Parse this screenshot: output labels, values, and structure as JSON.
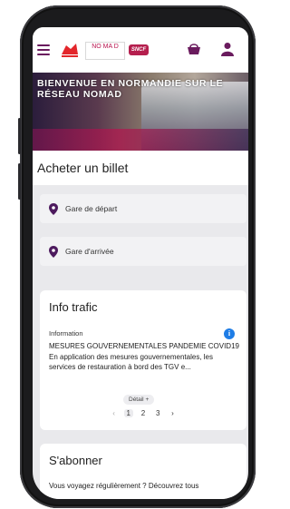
{
  "header": {
    "menu_icon": "hamburger-icon",
    "logos": [
      "region-normandie-logo",
      "nomad-logo",
      "sncf-logo"
    ],
    "nomad_logo_text": "NO MA D",
    "sncf_logo_text": "SNCF",
    "basket_icon": "basket-icon",
    "user_icon": "user-icon",
    "accent_color": "#6a1b5e"
  },
  "hero": {
    "title": "BIENVENUE EN NORMANDIE SUR LE RÉSEAU NOMAD"
  },
  "booking": {
    "title": "Acheter un billet",
    "departure_placeholder": "Gare de départ",
    "arrival_placeholder": "Gare d'arrivée",
    "pin_icon": "location-pin-icon"
  },
  "traffic": {
    "title": "Info trafic",
    "label": "Information",
    "info_icon": "info-icon",
    "headline": "MESURES GOUVERNEMENTALES PANDEMIE COVID19",
    "body": "En application des mesures gouvernementales, les services de restauration à bord des TGV e...",
    "detail_label": "Détail",
    "detail_icon": "+",
    "pagination": {
      "prev": "‹",
      "pages": [
        "1",
        "2",
        "3"
      ],
      "current": "1",
      "next": "›"
    }
  },
  "subscribe": {
    "title": "S'abonner",
    "body": "Vous voyagez régulièrement ? Découvrez tous"
  }
}
